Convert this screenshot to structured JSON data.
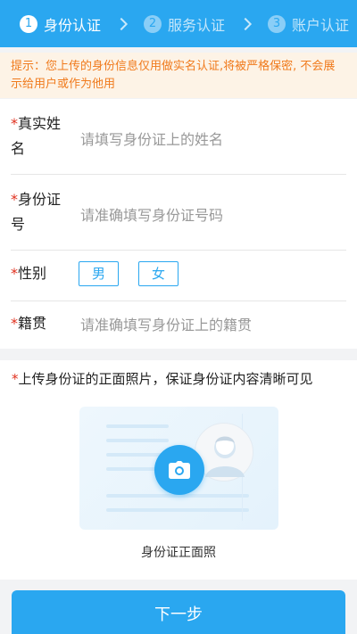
{
  "steps": [
    {
      "num": "1",
      "label": "身份认证",
      "state": "active"
    },
    {
      "num": "2",
      "label": "服务认证",
      "state": "inactive"
    },
    {
      "num": "3",
      "label": "账户认证",
      "state": "inactive"
    }
  ],
  "notice": {
    "text": "提示：您上传的身份信息仅用做实名认证,将被严格保密, 不会展示给用户或作为他用"
  },
  "form": {
    "required_mark": "*",
    "name_label_line1": "真实姓",
    "name_label_line2": "名",
    "name_placeholder": "请填写身份证上的姓名",
    "id_label_line1": "身份证",
    "id_label_line2": "号",
    "id_placeholder": "请准确填写身份证号码",
    "gender_label": "性别",
    "gender_male": "男",
    "gender_female": "女",
    "origin_label": "籍贯",
    "origin_placeholder": "请准确填写身份证上的籍贯"
  },
  "upload": {
    "title": "上传身份证的正面照片，保证身份证内容清晰可见",
    "caption": "身份证正面照",
    "icon": "camera-icon"
  },
  "next_button": {
    "label": "下一步"
  },
  "colors": {
    "accent": "#2aa7f0",
    "warning_text": "#f07a1c",
    "warning_bg": "#fdf3e6",
    "required": "#e0301e"
  }
}
